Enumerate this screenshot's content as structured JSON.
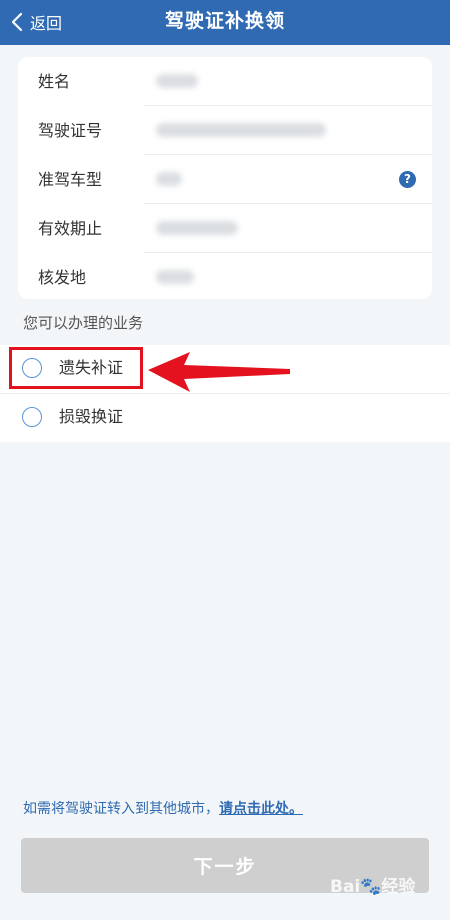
{
  "header": {
    "back_label": "返回",
    "title": "驾驶证补换领"
  },
  "info": {
    "rows": [
      {
        "label": "姓名"
      },
      {
        "label": "驾驶证号"
      },
      {
        "label": "准驾车型"
      },
      {
        "label": "有效期止"
      },
      {
        "label": "核发地"
      }
    ],
    "help_glyph": "?"
  },
  "services": {
    "title": "您可以办理的业务",
    "options": [
      {
        "label": "遗失补证"
      },
      {
        "label": "损毁换证"
      }
    ]
  },
  "transfer": {
    "text": "如需将驾驶证转入到其他城市，",
    "link": "请点击此处。"
  },
  "next_button": {
    "label": "下一步"
  },
  "watermark": {
    "text": "Bai🐾经验"
  },
  "colors": {
    "header": "#2f6ab2",
    "highlight": "#e3121e",
    "radio": "#5a95d6",
    "disabled_button": "#cfcfcf"
  }
}
